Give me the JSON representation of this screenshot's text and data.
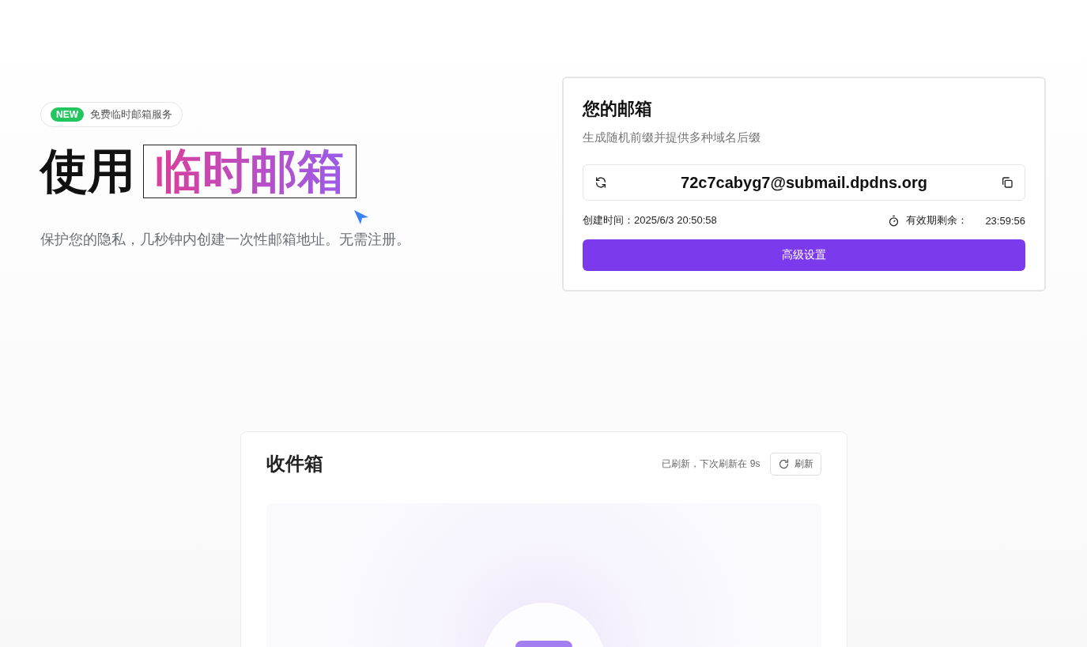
{
  "hero": {
    "badge": {
      "tag": "NEW",
      "text": "免费临时邮箱服务"
    },
    "title": {
      "plain": "使用",
      "highlight": "临时邮箱"
    },
    "subtitle": "保护您的隐私，几秒钟内创建一次性邮箱地址。无需注册。"
  },
  "mailbox_card": {
    "title": "您的邮箱",
    "subtitle": "生成随机前缀并提供多种域名后缀",
    "address": "72c7cabyg7@submail.dpdns.org",
    "created_label": "创建时间：",
    "created_value": "2025/6/3 20:50:58",
    "remaining_label": "有效期剩余：",
    "remaining_value": "23:59:56",
    "settings_button": "高级设置"
  },
  "inbox": {
    "title": "收件箱",
    "refresh_status": "已刷新，下次刷新在 9s",
    "refresh_button": "刷新"
  }
}
